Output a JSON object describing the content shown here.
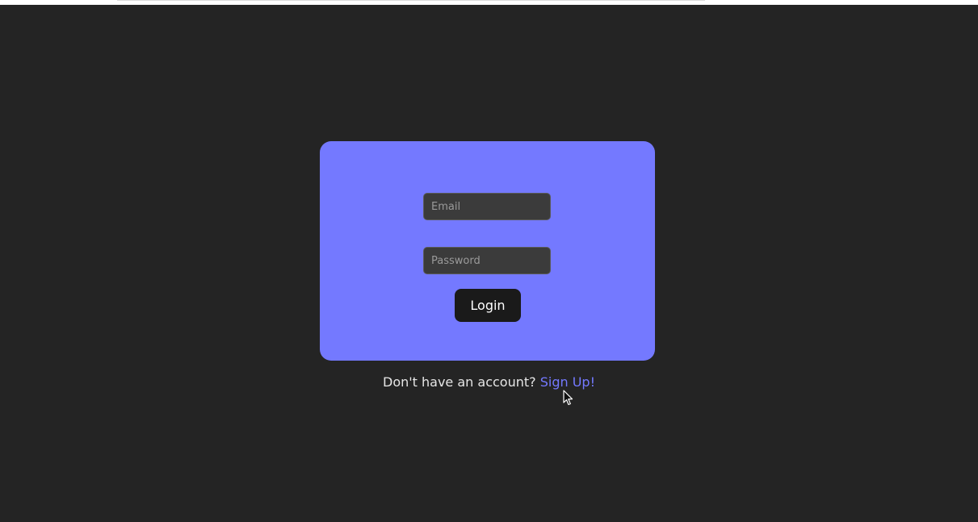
{
  "login": {
    "email_placeholder": "Email",
    "password_placeholder": "Password",
    "login_label": "Login"
  },
  "signup": {
    "prompt": "Don't have an account?",
    "link_label": "Sign Up!"
  },
  "colors": {
    "background": "#242424",
    "card": "#7479ff",
    "button": "#1a1a1a",
    "link": "#7479ff"
  },
  "icons": {
    "cursor": "mouse-pointer-icon"
  }
}
